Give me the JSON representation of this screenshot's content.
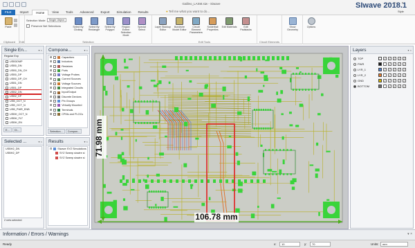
{
  "window": {
    "title": "Galileo_LASM.siw - Siwave",
    "brand": "SIwave 2018.1",
    "style_label": "Style"
  },
  "menu": {
    "tabs": [
      "FILE",
      "Import",
      "Home",
      "View",
      "Tools",
      "Advanced",
      "Export",
      "Simulation",
      "Results"
    ],
    "active": "Home",
    "tell_me": "Tell me what you want to do..."
  },
  "ribbon": {
    "clipboard_label": "Clipboard",
    "paste_label": "Paste",
    "edit_label": "Edit",
    "selection_mode_label": "Selection Mode",
    "selection_mode_value": "Single Object",
    "preserve_net_label": "Preserve Net Selections",
    "selection_group_label": "Selection",
    "select_buttons": [
      "Select By Clicking",
      "Select By Rectangle",
      "Select By Polygon",
      "Region Extent Selection Mode",
      "Special Select"
    ],
    "edit_tools_label": "Edit Tools",
    "edit_tool_buttons": [
      "Layer Stackup Editor",
      "Bondwire Model Editor",
      "Circuit Element Parameters",
      "Solderball Properties",
      "Edit Materials",
      "Edit Padstacks"
    ],
    "circuit_elements_label": "Circuit Elements",
    "show_geometry": "Show Geometry",
    "options": "Options"
  },
  "single_ended": {
    "title": "Single En...",
    "filter_label": "Regular Exp",
    "items": [
      "USB3OMP",
      "USB0_DN",
      "USB0_DN_CH",
      "USB0_DP",
      "USB0_DP_CH",
      "USB1_DN",
      "USB1_DP",
      "USB2_DN",
      "USB2_DP",
      "USB_DCT_N",
      "USB_OCT_N",
      "USB_PWR_ENB",
      "USBH_OCT_N",
      "USBH_FLT",
      "USBH_EN"
    ],
    "tabs": [
      "E...",
      "Ct..."
    ]
  },
  "components": {
    "title": "Compone...",
    "items": [
      "Capacitors",
      "Inductors",
      "Resistors",
      "Ports",
      "Voltage Probes",
      "Current Sources",
      "Voltage Sources",
      "Integrated Circuits",
      "Input/Output",
      "Discrete Devices",
      "Pin Groups",
      "Virtually Mounted",
      "Terminals",
      "CPMs and PLOCs"
    ],
    "tabs": [
      "Selection...",
      "Compon..."
    ]
  },
  "selected": {
    "title": "Selected ...",
    "items": [
      "USBH2_DN",
      "USBH2_DP"
    ],
    "footer": "2 nets selected"
  },
  "results": {
    "title": "Results",
    "root": "SIwave SYZ Simulations",
    "children": [
      "SYZ Sweep sixwire si",
      "SYZ Sweep sixwire si"
    ]
  },
  "layers": {
    "title": "Layers",
    "items": [
      {
        "name": "TOP",
        "color": "#f7f7f7"
      },
      {
        "name": "PWR",
        "color": "#1a1a1a"
      },
      {
        "name": "LYR_1",
        "color": "#4e7fd0"
      },
      {
        "name": "LYR_2",
        "color": "#e37b2a"
      },
      {
        "name": "GND",
        "color": "#d4b400"
      },
      {
        "name": "BOTTOM",
        "color": "#6c6c6c"
      }
    ],
    "active": "BOTTOM"
  },
  "canvas": {
    "dim_height": "71.98 mm",
    "dim_width": "106.78 mm",
    "board_color": "#c9cbc4",
    "pad_color": "#39d43a",
    "trace_color": "#b8b023",
    "highlight_color": "#e02020",
    "dim_arrow_color": "#4caf1a"
  },
  "info": {
    "title": "Information / Errors / Warnings"
  },
  "status": {
    "ready": "Ready",
    "x_label": "x:",
    "x_value": "10",
    "y_label": "y:",
    "y_value": "70",
    "units_label": "Units:",
    "units_value": "mm"
  }
}
